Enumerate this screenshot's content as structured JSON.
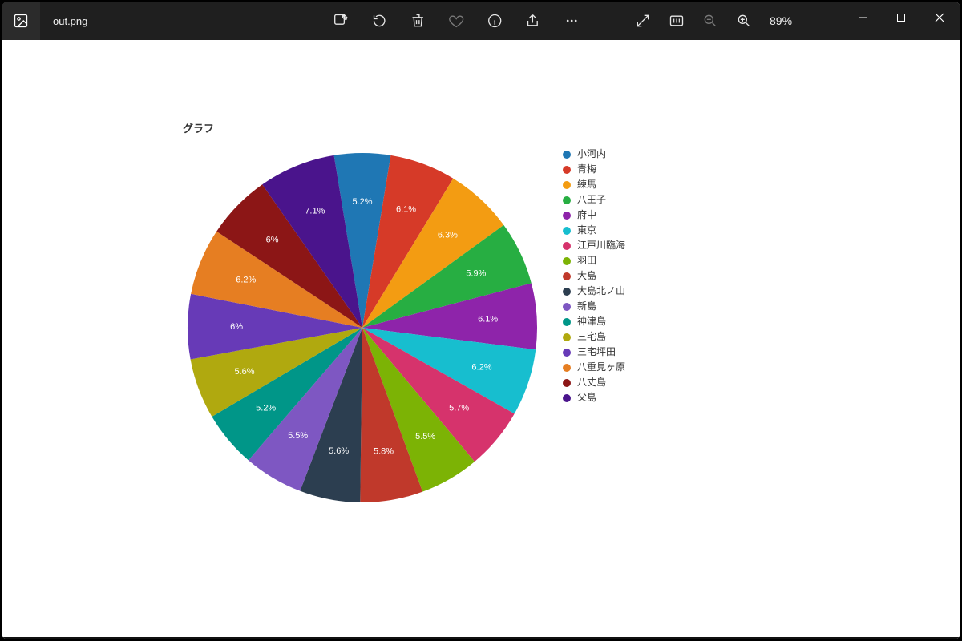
{
  "window": {
    "filename": "out.png",
    "zoom_label": "89%"
  },
  "chart_data": {
    "type": "pie",
    "title": "グラフ",
    "series": [
      {
        "name": "小河内",
        "value": 5.2,
        "label": "5.2%",
        "color": "#1f77b4"
      },
      {
        "name": "青梅",
        "value": 6.1,
        "label": "6.1%",
        "color": "#d63a28"
      },
      {
        "name": "練馬",
        "value": 6.3,
        "label": "6.3%",
        "color": "#f39c12"
      },
      {
        "name": "八王子",
        "value": 5.9,
        "label": "5.9%",
        "color": "#27ae42"
      },
      {
        "name": "府中",
        "value": 6.1,
        "label": "6.1%",
        "color": "#8e24aa"
      },
      {
        "name": "東京",
        "value": 6.2,
        "label": "6.2%",
        "color": "#17becf"
      },
      {
        "name": "江戸川臨海",
        "value": 5.7,
        "label": "5.7%",
        "color": "#d6336c"
      },
      {
        "name": "羽田",
        "value": 5.5,
        "label": "5.5%",
        "color": "#7cb305"
      },
      {
        "name": "大島",
        "value": 5.8,
        "label": "5.8%",
        "color": "#c0392b"
      },
      {
        "name": "大島北ノ山",
        "value": 5.6,
        "label": "5.6%",
        "color": "#2c3e50"
      },
      {
        "name": "新島",
        "value": 5.5,
        "label": "5.5%",
        "color": "#7e57c2"
      },
      {
        "name": "神津島",
        "value": 5.2,
        "label": "5.2%",
        "color": "#009688"
      },
      {
        "name": "三宅島",
        "value": 5.6,
        "label": "5.6%",
        "color": "#b0a90f"
      },
      {
        "name": "三宅坪田",
        "value": 6.0,
        "label": "6%",
        "color": "#673ab7"
      },
      {
        "name": "八重見ヶ原",
        "value": 6.2,
        "label": "6.2%",
        "color": "#e67e22"
      },
      {
        "name": "八丈島",
        "value": 6.0,
        "label": "6%",
        "color": "#8c1616"
      },
      {
        "name": "父島",
        "value": 7.1,
        "label": "7.1%",
        "color": "#4a148c"
      }
    ]
  }
}
